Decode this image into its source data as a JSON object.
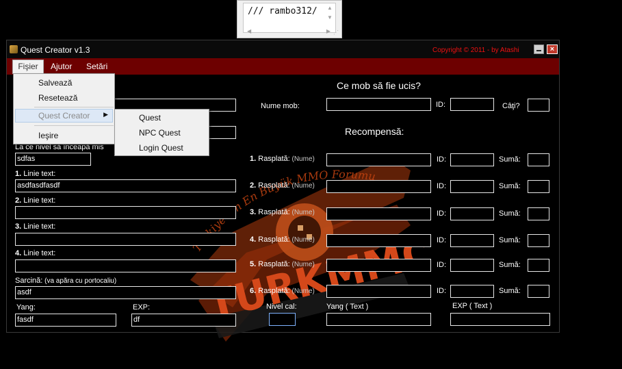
{
  "editor": {
    "text": "/// rambo312/"
  },
  "window": {
    "title": "Quest Creator v1.3",
    "copyright": "Copyright © 2011 - by Atashi",
    "close_glyph": "×"
  },
  "menubar": {
    "fisier": "Fişier",
    "ajutor": "Ajutor",
    "setari": "Setări"
  },
  "file_menu": {
    "items": [
      "Salvează",
      "Resetează",
      "Quest Creator",
      "Ieşire"
    ],
    "submenu": [
      "Quest",
      "NPC Quest",
      "Login Quest"
    ]
  },
  "left": {
    "level_label": "La ce nivel să înceapă mis",
    "level_value": "sdfas",
    "lines": [
      {
        "num": "1.",
        "label": " Linie text:",
        "value": "asdfasdfasdf"
      },
      {
        "num": "2.",
        "label": " Linie text:",
        "value": ""
      },
      {
        "num": "3.",
        "label": " Linie text:",
        "value": ""
      },
      {
        "num": "4.",
        "label": " Linie text:",
        "value": ""
      }
    ],
    "task_label": "Sarcină:",
    "task_hint": " (va apăra cu portocaliu)",
    "task_value": "asdf",
    "yang_label": "Yang:",
    "yang_value": "fasdf",
    "exp_label": "EXP:",
    "exp_value": "df"
  },
  "right": {
    "mob_heading": "Ce mob să fie ucis?",
    "mob_name_label": "Nume mob:",
    "id_label": "ID:",
    "count_label": "Câţi?",
    "reward_heading": "Recompensă:",
    "rewards": [
      {
        "num": "1.",
        "label": " Rasplată:",
        "hint": " (Nume)",
        "sum_label": "Sumă:"
      },
      {
        "num": "2.",
        "label": " Rasplată:",
        "hint": " (Nume)",
        "sum_label": "Sumă:"
      },
      {
        "num": "3.",
        "label": " Rasplată:",
        "hint": " (Nume)",
        "sum_label": "Sumă:"
      },
      {
        "num": "4.",
        "label": " Rasplată:",
        "hint": " (Nume)",
        "sum_label": "Sumă:"
      },
      {
        "num": "5.",
        "label": " Rasplată:",
        "hint": " (Nume)",
        "sum_label": "Sumă:"
      },
      {
        "num": "6.",
        "label": " Rasplată:",
        "hint": " (Nume)",
        "sum_label": "Sumă:"
      }
    ],
    "nivel_cal_label": "Nivel cal:",
    "yang_text_label": "Yang ( Text )",
    "exp_text_label": "EXP ( Text )"
  },
  "watermark": {
    "arc_text": "Türkiye'nin En Büyük MMO Forumu",
    "brand": "TURKMMO"
  },
  "colors": {
    "menubar": "#6d0000",
    "copyright": "#e11111",
    "watermark": "#d44a16"
  }
}
